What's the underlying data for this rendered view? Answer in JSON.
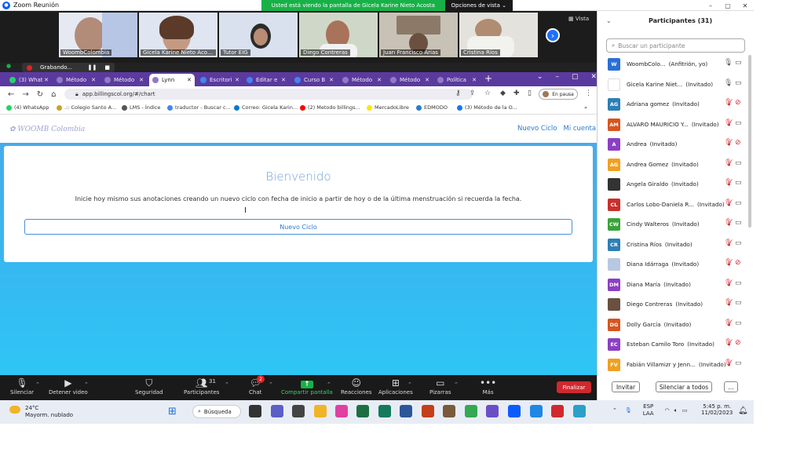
{
  "zoom": {
    "window_title": "Zoom Reunión",
    "share_banner": "Usted está viendo la pantalla de Gicela Karine Nieto Acosta",
    "view_options": "Opciones de vista",
    "view_label": "Vista",
    "recording_label": "Grabando...",
    "videos": [
      {
        "name": "WoombColombia"
      },
      {
        "name": "Gicela Karine Nieto Acosta"
      },
      {
        "name": "Tutor EIG"
      },
      {
        "name": "Diego Contreras"
      },
      {
        "name": "Juan Francisco Arias"
      },
      {
        "name": "Cristina Ríos"
      }
    ],
    "toolbar": {
      "mute": "Silenciar",
      "stop_video": "Detener video",
      "security": "Seguridad",
      "participants": "Participantes",
      "participants_count": "31",
      "chat": "Chat",
      "chat_badge": "2",
      "share": "Compartir pantalla",
      "reactions": "Reacciones",
      "apps": "Aplicaciones",
      "whiteboards": "Pizarras",
      "more": "Más",
      "end": "Finalizar"
    }
  },
  "browser": {
    "tabs": [
      {
        "label": "(3) What",
        "color": "#25d366"
      },
      {
        "label": "Método",
        "color": "#8e7cc3"
      },
      {
        "label": "Método",
        "color": "#8e7cc3"
      },
      {
        "label": "Lynn",
        "color": "#8e7cc3"
      },
      {
        "label": "Escritori",
        "color": "#4285f4"
      },
      {
        "label": "Editar e",
        "color": "#4285f4"
      },
      {
        "label": "Curso B",
        "color": "#4285f4"
      },
      {
        "label": "Método",
        "color": "#8e7cc3"
      },
      {
        "label": "Método",
        "color": "#8e7cc3"
      },
      {
        "label": "Política",
        "color": "#8e7cc3"
      }
    ],
    "url": "app.billingscol.org/#/chart",
    "pause_label": "En pausa",
    "bookmarks": [
      {
        "label": "(4) WhatsApp",
        "color": "#25d366"
      },
      {
        "label": ".:: Colegio Santo A...",
        "color": "#c9a227"
      },
      {
        "label": "LMS - Índice",
        "color": "#555555"
      },
      {
        "label": "traductor - Buscar c...",
        "color": "#4285f4"
      },
      {
        "label": "Correo: Gicela Karin...",
        "color": "#0078d4"
      },
      {
        "label": "(2) Metodo billings...",
        "color": "#ff0000"
      },
      {
        "label": "MercadoLibre",
        "color": "#ffe600"
      },
      {
        "label": "EDMODO",
        "color": "#2a7bd4"
      },
      {
        "label": "(3) Método de la O...",
        "color": "#1877f2"
      }
    ]
  },
  "site": {
    "logo": "WOOMB Colombia",
    "nav": [
      "Nuevo Ciclo",
      "Mi cuenta"
    ],
    "welcome": "Bienvenido",
    "intro": "Inicie hoy mismo sus anotaciones creando un nuevo ciclo con fecha de inicio a partir de hoy o de la última menstruación si recuerda la fecha.",
    "new_cycle_button": "Nuevo Ciclo"
  },
  "participants": {
    "title": "Participantes (31)",
    "search_placeholder": "Buscar un participante",
    "list": [
      {
        "initials": "W",
        "color": "#2a6fd6",
        "name": "WoombColo...",
        "role": "(Anfitrión, yo)",
        "mic": "on",
        "cam": "on"
      },
      {
        "initials": "",
        "color": "#ffffff",
        "name": "Gicela Karine Niet...",
        "role": "(Invitado)",
        "mic": "on",
        "cam": "on"
      },
      {
        "initials": "AG",
        "color": "#2e7fb5",
        "name": "Adriana gomez",
        "role": "(Invitado)",
        "mic": "off",
        "cam": "off"
      },
      {
        "initials": "AM",
        "color": "#d9541e",
        "name": "ALVARO MAURICIO Y...",
        "role": "(Invitado)",
        "mic": "off",
        "cam": "on"
      },
      {
        "initials": "A",
        "color": "#8b3fc4",
        "name": "Andrea",
        "role": "(Invitado)",
        "mic": "off",
        "cam": "off"
      },
      {
        "initials": "AG",
        "color": "#f0a020",
        "name": "Andrea Gomez",
        "role": "(Invitado)",
        "mic": "off",
        "cam": "on"
      },
      {
        "initials": "",
        "color": "#333333",
        "name": "Angela Giraldo",
        "role": "(Invitado)",
        "mic": "off",
        "cam": "on"
      },
      {
        "initials": "CL",
        "color": "#c9302c",
        "name": "Carlos Lobo-Daniela R...",
        "role": "(Invitado)",
        "mic": "off",
        "cam": "on"
      },
      {
        "initials": "CW",
        "color": "#3aa33a",
        "name": "Cindy Walteros",
        "role": "(Invitado)",
        "mic": "off",
        "cam": "on"
      },
      {
        "initials": "CR",
        "color": "#2e7fb5",
        "name": "Cristina Ríos",
        "role": "(Invitado)",
        "mic": "off",
        "cam": "on"
      },
      {
        "initials": "",
        "color": "#b8c8e0",
        "name": "Diana Idárraga",
        "role": "(Invitado)",
        "mic": "off",
        "cam": "off"
      },
      {
        "initials": "DM",
        "color": "#8b3fc4",
        "name": "Diana María",
        "role": "(Invitado)",
        "mic": "off",
        "cam": "on"
      },
      {
        "initials": "",
        "color": "#6a5040",
        "name": "Diego Contreras",
        "role": "(Invitado)",
        "mic": "off",
        "cam": "on"
      },
      {
        "initials": "DG",
        "color": "#d9541e",
        "name": "Dolly García",
        "role": "(Invitado)",
        "mic": "off",
        "cam": "on"
      },
      {
        "initials": "EC",
        "color": "#8b3fc4",
        "name": "Esteban Camilo Toro",
        "role": "(Invitado)",
        "mic": "off",
        "cam": "off"
      },
      {
        "initials": "FV",
        "color": "#f0a020",
        "name": "Fabián Villamizr y Jenn...",
        "role": "(Invitado)",
        "mic": "off",
        "cam": "on"
      }
    ],
    "invite": "Invitar",
    "mute_all": "Silenciar a todos",
    "more": "..."
  },
  "taskbar": {
    "temp": "24°C",
    "weather": "Mayorm. nublado",
    "search": "Búsqueda",
    "lang": "ESP",
    "lang2": "LAA",
    "time": "5:45 p. m.",
    "date": "11/02/2023"
  }
}
